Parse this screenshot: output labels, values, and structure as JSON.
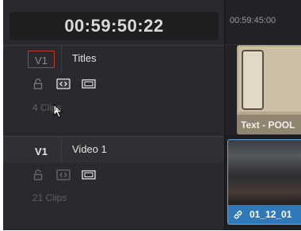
{
  "header": {
    "timecode": "00:59:50:22"
  },
  "ruler": {
    "timecode": "00:59:45:00"
  },
  "tracks": [
    {
      "label": "V1",
      "name": "Titles",
      "clips": "4 Clips",
      "selected_outline": true
    },
    {
      "label": "V1",
      "name": "Video 1",
      "clips": "21 Clips",
      "selected_outline": false
    }
  ],
  "timeline_clips": [
    {
      "name": "Text - POOL",
      "color": "#b7a88c"
    },
    {
      "name": "01_12_01",
      "color": "#2f79b8"
    }
  ],
  "colors": {
    "panel": "#2a2a2e",
    "timeline": "#1c1c1f",
    "destination_outline": "#c23a2e",
    "video_clip": "#2f79b8",
    "title_clip": "#b7a88c"
  },
  "icons": [
    "lock-icon",
    "auto-select-icon",
    "disable-video-icon",
    "link-icon",
    "mouse-pointer-icon"
  ]
}
